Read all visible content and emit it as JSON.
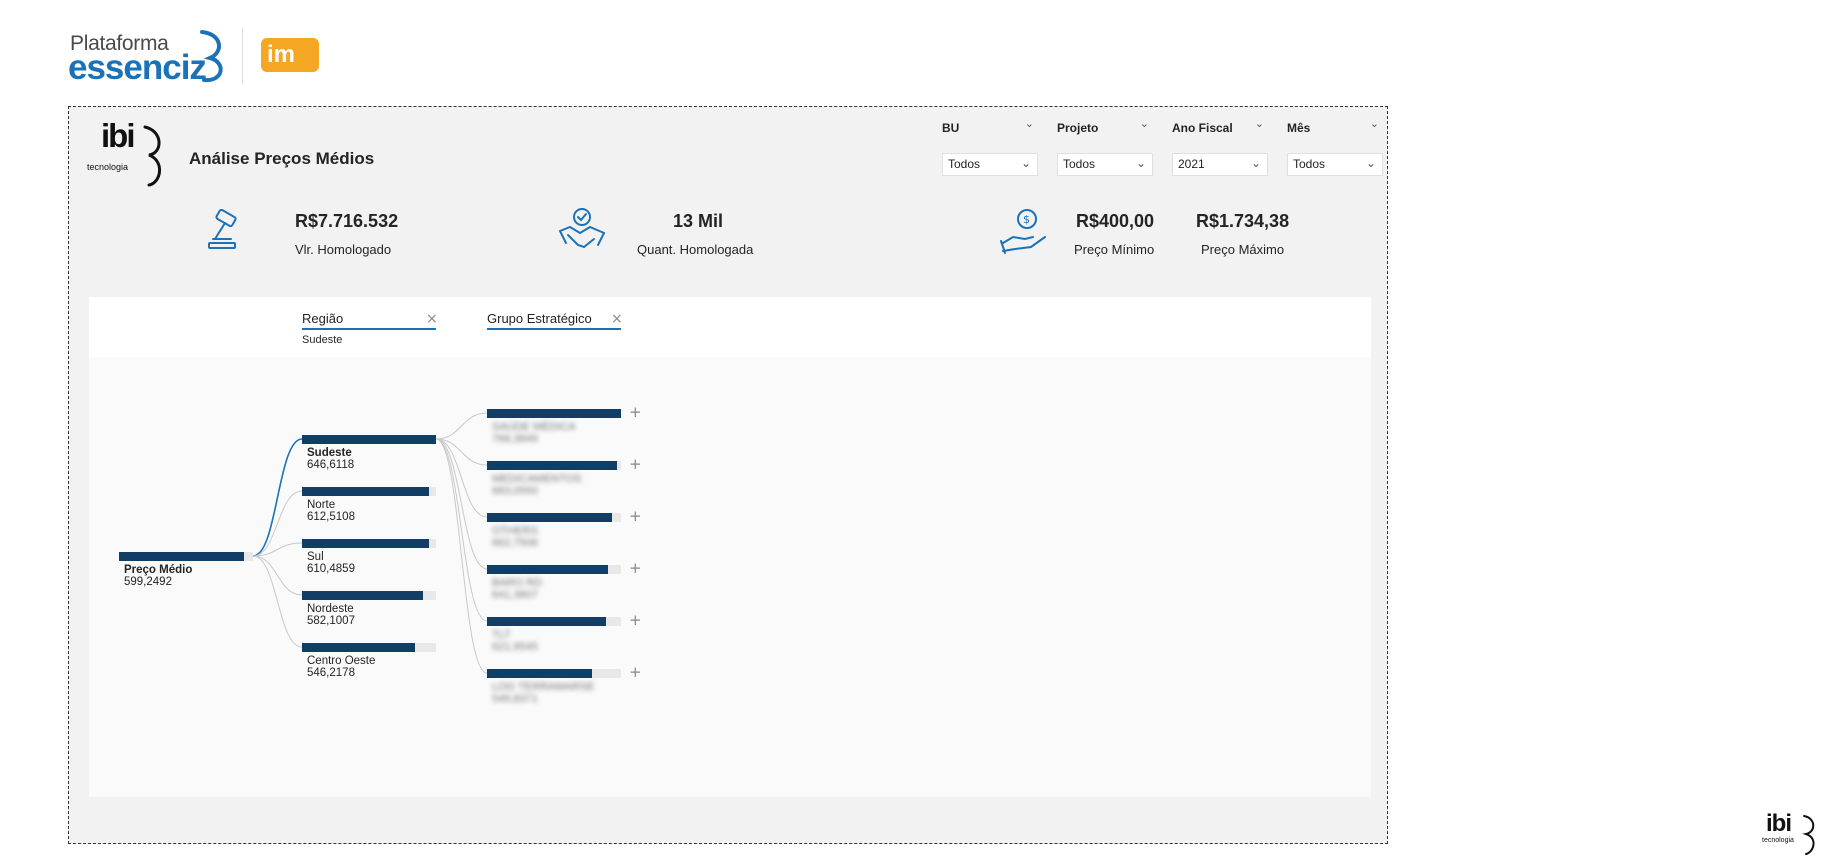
{
  "brand": {
    "essenciz_small": "Plataforma",
    "essenciz_big": "essenciz",
    "im_logo": "im",
    "ibi_logo": "ibi",
    "ibi_sub": "tecnologia"
  },
  "report": {
    "title": "Análise Preços Médios"
  },
  "slicers": [
    {
      "label": "BU",
      "value": "Todos"
    },
    {
      "label": "Projeto",
      "value": "Todos"
    },
    {
      "label": "Ano Fiscal",
      "value": "2021"
    },
    {
      "label": "Mês",
      "value": "Todos"
    }
  ],
  "kpis": {
    "valor_homologado": {
      "value": "R$7.716.532",
      "label": "Vlr. Homologado"
    },
    "quant_homologada": {
      "value": "13 Mil",
      "label": "Quant. Homologada"
    },
    "preco_minimo": {
      "value": "R$400,00",
      "label": "Preço Mínimo"
    },
    "preco_maximo": {
      "value": "R$1.734,38",
      "label": "Preço Máximo"
    }
  },
  "decomposition": {
    "levels": [
      {
        "title": "Região",
        "selected": "Sudeste"
      },
      {
        "title": "Grupo Estratégico"
      }
    ],
    "root": {
      "name": "Preço Médio",
      "value": "599,2492",
      "fraction": 0.93
    },
    "regions": [
      {
        "name": "Sudeste",
        "value": "646,6118",
        "fraction": 1.0,
        "selected": true
      },
      {
        "name": "Norte",
        "value": "612,5108",
        "fraction": 0.95
      },
      {
        "name": "Sul",
        "value": "610,4859",
        "fraction": 0.945
      },
      {
        "name": "Nordeste",
        "value": "582,1007",
        "fraction": 0.9
      },
      {
        "name": "Centro Oeste",
        "value": "546,2178",
        "fraction": 0.845
      }
    ],
    "groups": [
      {
        "name": "SAÚDE MÉDICA",
        "value": "768,3849",
        "fraction": 1.0
      },
      {
        "name": "MEDICAMENTOS",
        "value": "683,0550",
        "fraction": 0.97
      },
      {
        "name": "OTHERS",
        "value": "662,7506",
        "fraction": 0.935
      },
      {
        "name": "BARO RD",
        "value": "641,3807",
        "fraction": 0.905
      },
      {
        "name": "TLT",
        "value": "621,9545",
        "fraction": 0.89
      },
      {
        "name": "LOG TERRAMARSE",
        "value": "549,8371",
        "fraction": 0.78
      }
    ]
  },
  "colors": {
    "bar": "#123e66",
    "accent": "#1a73b8",
    "brand_orange": "#f5a623"
  }
}
